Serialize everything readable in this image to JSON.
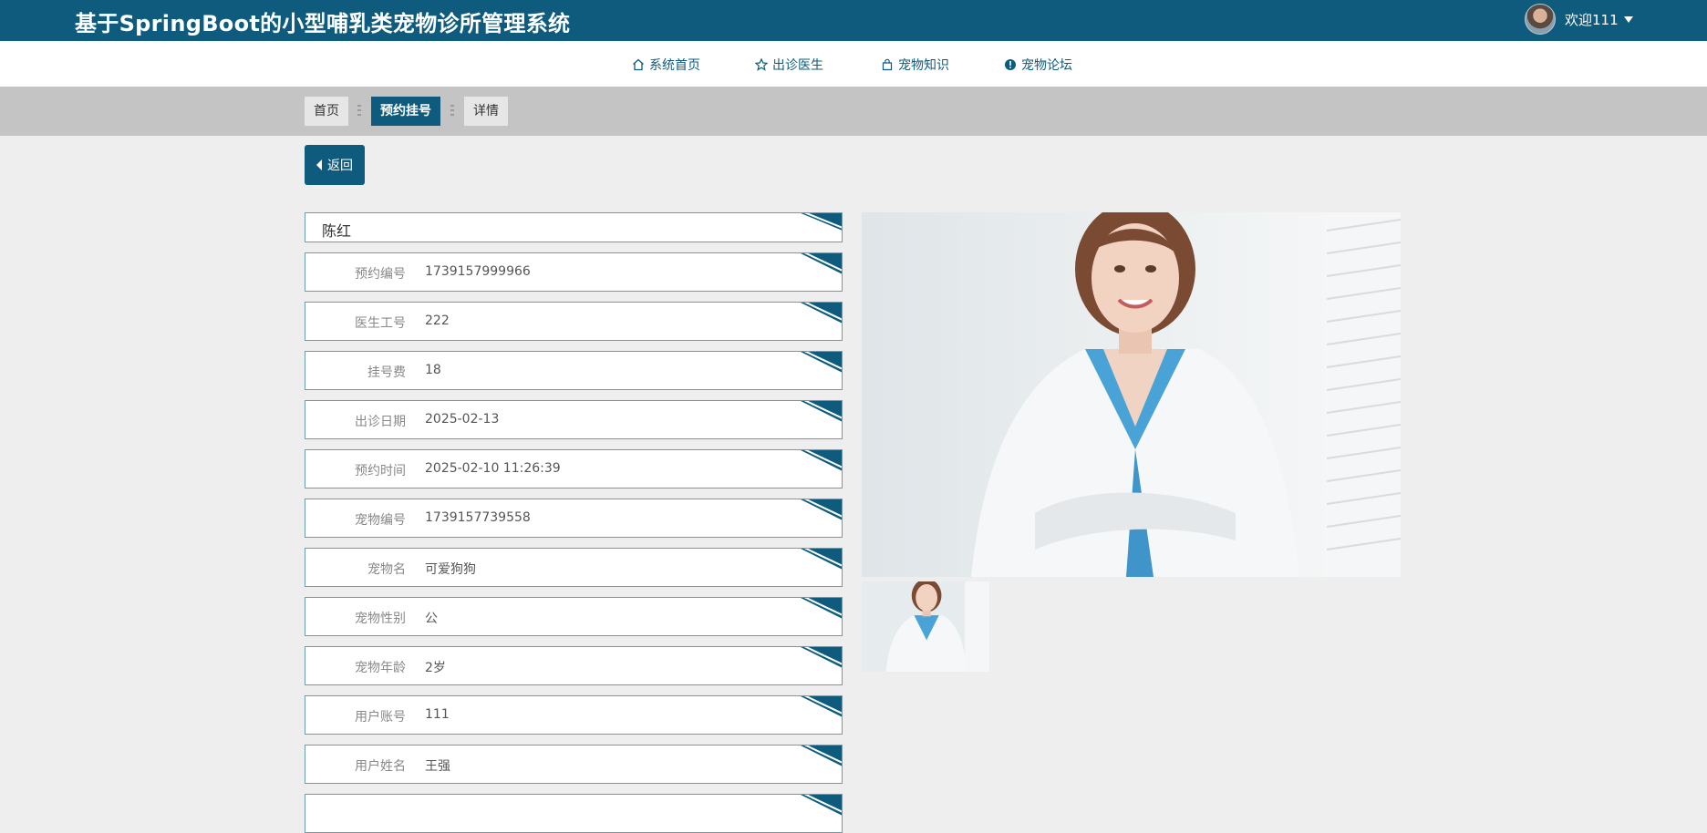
{
  "header": {
    "site_title": "基于SpringBoot的小型哺乳类宠物诊所管理系统",
    "welcome": "欢迎111"
  },
  "nav": [
    {
      "label": "系统首页",
      "icon": "home-icon"
    },
    {
      "label": "出诊医生",
      "icon": "star-icon"
    },
    {
      "label": "宠物知识",
      "icon": "bag-icon"
    },
    {
      "label": "宠物论坛",
      "icon": "info-circle-icon"
    }
  ],
  "breadcrumb": [
    "首页",
    "预约挂号",
    "详情"
  ],
  "back_label": "返回",
  "detail": {
    "doctor_name": "陈红",
    "fields": [
      {
        "label": "预约编号",
        "value": "1739157999966"
      },
      {
        "label": "医生工号",
        "value": "222"
      },
      {
        "label": "挂号费",
        "value": "18"
      },
      {
        "label": "出诊日期",
        "value": "2025-02-13"
      },
      {
        "label": "预约时间",
        "value": "2025-02-10 11:26:39"
      },
      {
        "label": "宠物编号",
        "value": "1739157739558"
      },
      {
        "label": "宠物名",
        "value": "可爱狗狗"
      },
      {
        "label": "宠物性别",
        "value": "公"
      },
      {
        "label": "宠物年龄",
        "value": "2岁"
      },
      {
        "label": "用户账号",
        "value": "111"
      },
      {
        "label": "用户姓名",
        "value": "王强"
      },
      {
        "label": "",
        "value": ""
      }
    ]
  },
  "colors": {
    "primary": "#0e5b7d",
    "page_bg": "#efeeee",
    "crumb_band": "#c4c4c4"
  }
}
